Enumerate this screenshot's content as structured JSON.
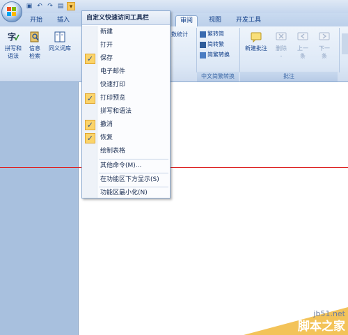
{
  "qat": {
    "icons": [
      "save-icon",
      "undo-icon",
      "redo-icon",
      "print-preview-icon",
      "customize-dropdown-icon"
    ]
  },
  "tabs": [
    {
      "label": "开始"
    },
    {
      "label": "插入"
    },
    {
      "label": "审阅",
      "active": true
    },
    {
      "label": "视图"
    },
    {
      "label": "开发工具"
    }
  ],
  "ribbon": {
    "proofing": {
      "spell_line1": "拼写和",
      "spell_line2": "语法",
      "research_line1": "信息",
      "research_line2": "检索",
      "thesaurus": "同义词库",
      "wordcount": "数统计"
    },
    "chinese_conversion": {
      "to_simplified": "繁转简",
      "to_traditional": "简转繁",
      "convert": "简繁转换",
      "group_label": "中文简繁转换"
    },
    "comments": {
      "new": "新建批注",
      "delete_line1": "删除",
      "delete_line2": "-",
      "prev_line1": "上一",
      "prev_line2": "条",
      "next_line1": "下一",
      "next_line2": "条",
      "group_label": "批注"
    }
  },
  "menu": {
    "title": "自定义快速访问工具栏",
    "items": [
      {
        "label": "新建",
        "checked": false
      },
      {
        "label": "打开",
        "checked": false
      },
      {
        "label": "保存",
        "checked": true
      },
      {
        "label": "电子邮件",
        "checked": false
      },
      {
        "label": "快速打印",
        "checked": false
      },
      {
        "label": "打印预览",
        "checked": true
      },
      {
        "label": "拼写和语法",
        "checked": false
      },
      {
        "label": "撤消",
        "checked": true
      },
      {
        "label": "恢复",
        "checked": true
      },
      {
        "label": "绘制表格",
        "checked": false
      },
      {
        "label": "其他命令(M)..."
      },
      {
        "label": "在功能区下方显示(S)"
      },
      {
        "label": "功能区最小化(N)"
      }
    ],
    "check_glyph": "✓"
  },
  "watermark": {
    "url": "jb51.net",
    "brand": "脚本之家"
  },
  "colors": {
    "accent": "#f7c95c",
    "ribbon": "#dde8f6",
    "page": "#ffffff",
    "marker_line": "#dd2222"
  }
}
